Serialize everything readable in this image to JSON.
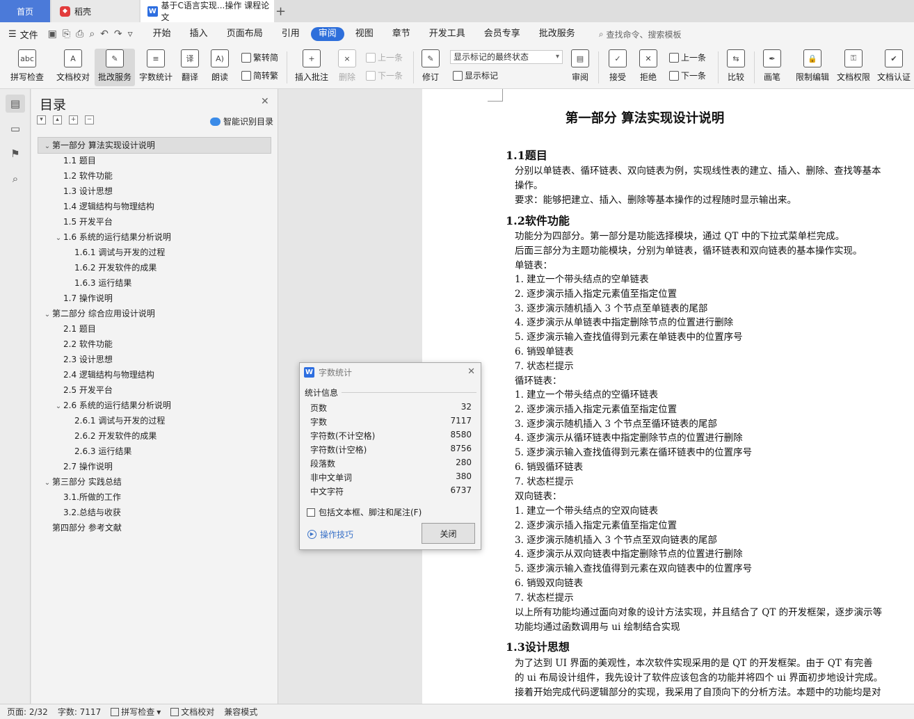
{
  "tabs": {
    "home": "首页",
    "daoke": "稻壳",
    "doc": "基于C语言实现...操作 课程论文",
    "plus": "+"
  },
  "menubar": {
    "file": "文件",
    "tabs": [
      "开始",
      "插入",
      "页面布局",
      "引用",
      "审阅",
      "视图",
      "章节",
      "开发工具",
      "会员专享",
      "批改服务"
    ],
    "active_index": 4,
    "search": "查找命令、搜索模板"
  },
  "ribbon": {
    "spellcheck": "拼写检查",
    "proofread": "文档校对",
    "review_service": "批改服务",
    "word_count": "字数统计",
    "translate": "翻译",
    "read_aloud": "朗读",
    "trad": "繁转简",
    "simp": "简转繁",
    "insert_comment": "插入批注",
    "delete": "删除",
    "prev": "上一条",
    "next": "下一条",
    "revise": "修订",
    "display_combo": "显示标记的最终状态",
    "show_marks": "显示标记",
    "review_pane": "审阅",
    "accept": "接受",
    "reject": "拒绝",
    "prev2": "上一条",
    "next2": "下一条",
    "compare": "比较",
    "pen": "画笔",
    "restrict_edit": "限制编辑",
    "doc_perm": "文档权限",
    "doc_auth": "文档认证"
  },
  "toc": {
    "title": "目录",
    "smart": "智能识别目录",
    "items": [
      {
        "label": "第一部分  算法实现设计说明",
        "level": 0,
        "arrow": "v"
      },
      {
        "label": "1.1 题目",
        "level": 1,
        "arrow": ""
      },
      {
        "label": "1.2 软件功能",
        "level": 1,
        "arrow": ""
      },
      {
        "label": "1.3 设计思想",
        "level": 1,
        "arrow": ""
      },
      {
        "label": "1.4 逻辑结构与物理结构",
        "level": 1,
        "arrow": ""
      },
      {
        "label": "1.5 开发平台",
        "level": 1,
        "arrow": ""
      },
      {
        "label": "1.6 系统的运行结果分析说明",
        "level": 1,
        "arrow": "v"
      },
      {
        "label": "1.6.1  调试与开发的过程",
        "level": 2,
        "arrow": ""
      },
      {
        "label": "1.6.2  开发软件的成果",
        "level": 2,
        "arrow": ""
      },
      {
        "label": "1.6.3  运行结果",
        "level": 2,
        "arrow": ""
      },
      {
        "label": "1.7 操作说明",
        "level": 1,
        "arrow": ""
      },
      {
        "label": "第二部分  综合应用设计说明",
        "level": 0,
        "arrow": "v"
      },
      {
        "label": "2.1 题目",
        "level": 1,
        "arrow": ""
      },
      {
        "label": "2.2 软件功能",
        "level": 1,
        "arrow": ""
      },
      {
        "label": "2.3 设计思想",
        "level": 1,
        "arrow": ""
      },
      {
        "label": "2.4 逻辑结构与物理结构",
        "level": 1,
        "arrow": ""
      },
      {
        "label": "2.5 开发平台",
        "level": 1,
        "arrow": ""
      },
      {
        "label": "2.6 系统的运行结果分析说明",
        "level": 1,
        "arrow": "v"
      },
      {
        "label": "2.6.1  调试与开发的过程",
        "level": 2,
        "arrow": ""
      },
      {
        "label": "2.6.2  开发软件的成果",
        "level": 2,
        "arrow": ""
      },
      {
        "label": "2.6.3  运行结果",
        "level": 2,
        "arrow": ""
      },
      {
        "label": "2.7 操作说明",
        "level": 1,
        "arrow": ""
      },
      {
        "label": "第三部分  实践总结",
        "level": 0,
        "arrow": "v"
      },
      {
        "label": "3.1.所做的工作",
        "level": 1,
        "arrow": ""
      },
      {
        "label": "3.2.总结与收获",
        "level": 1,
        "arrow": ""
      },
      {
        "label": "第四部分  参考文献",
        "level": 0,
        "arrow": ""
      }
    ]
  },
  "doc": {
    "title": "第一部分  算法实现设计说明",
    "h_1_1": "1.1题目",
    "p1": "分别以单链表、循环链表、双向链表为例，实现线性表的建立、插入、删除、查找等基本",
    "p1b": "操作。",
    "p2": "要求：能够把建立、插入、删除等基本操作的过程随时显示输出来。",
    "h_1_2": "1.2软件功能",
    "p3": "功能分为四部分。第一部分是功能选择模块，通过 QT 中的下拉式菜单栏完成。",
    "p4": "后面三部分为主题功能模块，分别为单链表，循环链表和双向链表的基本操作实现。",
    "single": "单链表：",
    "single_items": [
      "1.   建立一个带头结点的空单链表",
      "2.   逐步演示插入指定元素值至指定位置",
      "3.   逐步演示随机插入 3 个节点至单链表的尾部",
      "4.   逐步演示从单链表中指定删除节点的位置进行删除",
      "5.   逐步演示输入查找值得到元素在单链表中的位置序号",
      "6.   销毁单链表",
      "7.   状态栏提示"
    ],
    "circular": "循环链表：",
    "circular_items": [
      "1.   建立一个带头结点的空循环链表",
      "2.   逐步演示插入指定元素值至指定位置",
      "3.   逐步演示随机插入 3 个节点至循环链表的尾部",
      "4.   逐步演示从循环链表中指定删除节点的位置进行删除",
      "5.   逐步演示输入查找值得到元素在循环链表中的位置序号",
      "6.   销毁循环链表",
      "7.   状态栏提示"
    ],
    "double": "双向链表：",
    "double_items": [
      "1.   建立一个带头结点的空双向链表",
      "2.   逐步演示插入指定元素值至指定位置",
      "3.   逐步演示随机插入 3 个节点至双向链表的尾部",
      "4.   逐步演示从双向链表中指定删除节点的位置进行删除",
      "5.   逐步演示输入查找值得到元素在双向链表中的位置序号",
      "6.   销毁双向链表",
      "7.   状态栏提示"
    ],
    "p5": "以上所有功能均通过面向对象的设计方法实现，并且结合了 QT 的开发框架，逐步演示等",
    "p5b": "功能均通过函数调用与 ui 绘制结合实现",
    "h_1_3": "1.3设计思想",
    "p6": "    为了达到 UI 界面的美观性，本次软件实现采用的是 QT 的开发框架。由于 QT 有完善",
    "p6b": "的 ui 布局设计组件，我先设计了软件应该包含的功能并将四个 ui 界面初步地设计完成。",
    "p6c": "接着开始完成代码逻辑部分的实现，我采用了自顶向下的分析方法。本题中的功能均是对"
  },
  "dialog": {
    "title": "字数统计",
    "section": "统计信息",
    "stats": [
      {
        "label": "页数",
        "value": "32"
      },
      {
        "label": "字数",
        "value": "7117"
      },
      {
        "label": "字符数(不计空格)",
        "value": "8580"
      },
      {
        "label": "字符数(计空格)",
        "value": "8756"
      },
      {
        "label": "段落数",
        "value": "280"
      },
      {
        "label": "非中文单词",
        "value": "380"
      },
      {
        "label": "中文字符",
        "value": "6737"
      }
    ],
    "include": "包括文本框、脚注和尾注(F)",
    "tips": "操作技巧",
    "close": "关闭"
  },
  "status": {
    "page": "页面: 2/32",
    "words": "字数: 7117",
    "spell": "拼写检查",
    "proof": "文档校对",
    "compat": "兼容模式"
  }
}
